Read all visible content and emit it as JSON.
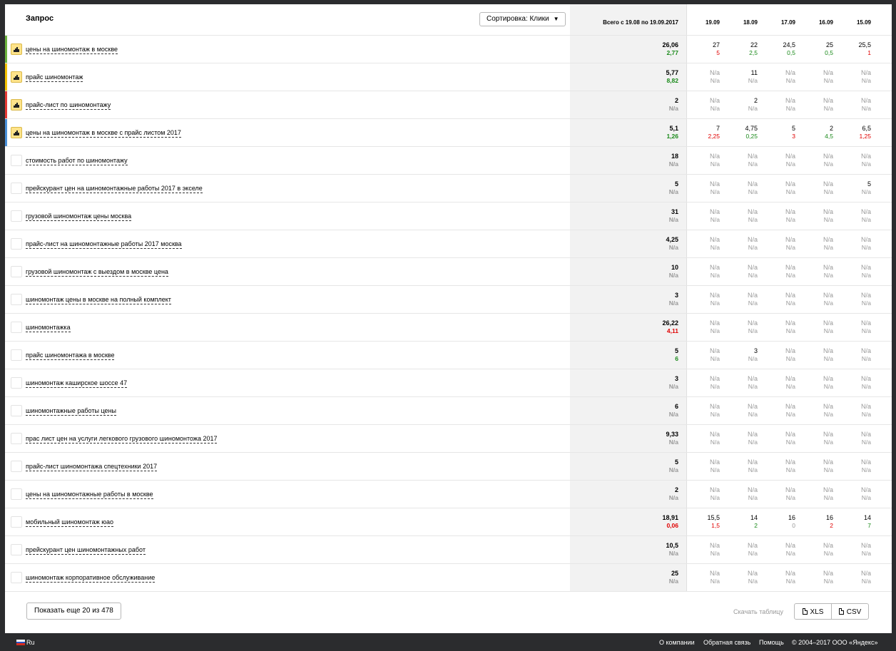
{
  "header": {
    "title": "Запрос",
    "sort_label": "Сортировка: Клики",
    "total_label": "Всего с 19.08 по 19.09.2017",
    "dates": [
      "19.09",
      "18.09",
      "17.09",
      "16.09",
      "15.09"
    ]
  },
  "colors": {
    "row_markers": [
      "#6cb33f",
      "#f2c200",
      "#e53935",
      "#4a90d9"
    ],
    "checkbox_on": "#ffe38a"
  },
  "rows": [
    {
      "query": "цены на шиномонтаж в москве",
      "checked": true,
      "marker": "#6cb33f",
      "total": {
        "a": "26,06",
        "b": "2,77",
        "bc": "green"
      },
      "days": [
        {
          "a": "27",
          "b": "5",
          "bc": "red"
        },
        {
          "a": "22",
          "b": "2,5",
          "bc": "green"
        },
        {
          "a": "24,5",
          "b": "0,5",
          "bc": "green"
        },
        {
          "a": "25",
          "b": "0,5",
          "bc": "green"
        },
        {
          "a": "25,5",
          "b": "1",
          "bc": "red"
        }
      ]
    },
    {
      "query": "прайс шиномонтаж",
      "checked": true,
      "marker": "#f2c200",
      "total": {
        "a": "5,77",
        "b": "8,82",
        "bc": "green"
      },
      "days": [
        {
          "a": "N/a",
          "b": "N/a"
        },
        {
          "a": "11",
          "b": "N/a"
        },
        {
          "a": "N/a",
          "b": "N/a"
        },
        {
          "a": "N/a",
          "b": "N/a"
        },
        {
          "a": "N/a",
          "b": "N/a"
        }
      ]
    },
    {
      "query": "прайс-лист по шиномонтажу",
      "checked": true,
      "marker": "#e53935",
      "total": {
        "a": "2",
        "b": "N/a"
      },
      "days": [
        {
          "a": "N/a",
          "b": "N/a"
        },
        {
          "a": "2",
          "b": "N/a"
        },
        {
          "a": "N/a",
          "b": "N/a"
        },
        {
          "a": "N/a",
          "b": "N/a"
        },
        {
          "a": "N/a",
          "b": "N/a"
        }
      ]
    },
    {
      "query": "цены на шиномонтаж в москве с прайс листом 2017",
      "checked": true,
      "marker": "#4a90d9",
      "total": {
        "a": "5,1",
        "b": "1,26",
        "bc": "green"
      },
      "days": [
        {
          "a": "7",
          "b": "2,25",
          "bc": "red"
        },
        {
          "a": "4,75",
          "b": "0,25",
          "bc": "green"
        },
        {
          "a": "5",
          "b": "3",
          "bc": "red"
        },
        {
          "a": "2",
          "b": "4,5",
          "bc": "green"
        },
        {
          "a": "6,5",
          "b": "1,25",
          "bc": "red"
        }
      ]
    },
    {
      "query": "стоимость работ по шиномонтажу",
      "total": {
        "a": "18",
        "b": "N/a"
      },
      "days": [
        {
          "a": "N/a",
          "b": "N/a"
        },
        {
          "a": "N/a",
          "b": "N/a"
        },
        {
          "a": "N/a",
          "b": "N/a"
        },
        {
          "a": "N/a",
          "b": "N/a"
        },
        {
          "a": "N/a",
          "b": "N/a"
        }
      ]
    },
    {
      "query": "прейскурант цен на шиномонтажные работы 2017 в экселе",
      "total": {
        "a": "5",
        "b": "N/a"
      },
      "days": [
        {
          "a": "N/a",
          "b": "N/a"
        },
        {
          "a": "N/a",
          "b": "N/a"
        },
        {
          "a": "N/a",
          "b": "N/a"
        },
        {
          "a": "N/a",
          "b": "N/a"
        },
        {
          "a": "5",
          "b": "N/a"
        }
      ]
    },
    {
      "query": "грузовой шиномонтаж цены москва",
      "total": {
        "a": "31",
        "b": "N/a"
      },
      "days": [
        {
          "a": "N/a",
          "b": "N/a"
        },
        {
          "a": "N/a",
          "b": "N/a"
        },
        {
          "a": "N/a",
          "b": "N/a"
        },
        {
          "a": "N/a",
          "b": "N/a"
        },
        {
          "a": "N/a",
          "b": "N/a"
        }
      ]
    },
    {
      "query": "прайс-лист на шиномонтажные работы 2017 москва",
      "total": {
        "a": "4,25",
        "b": "N/a"
      },
      "days": [
        {
          "a": "N/a",
          "b": "N/a"
        },
        {
          "a": "N/a",
          "b": "N/a"
        },
        {
          "a": "N/a",
          "b": "N/a"
        },
        {
          "a": "N/a",
          "b": "N/a"
        },
        {
          "a": "N/a",
          "b": "N/a"
        }
      ]
    },
    {
      "query": "грузовой шиномонтаж с выездом в москве цена",
      "total": {
        "a": "10",
        "b": "N/a"
      },
      "days": [
        {
          "a": "N/a",
          "b": "N/a"
        },
        {
          "a": "N/a",
          "b": "N/a"
        },
        {
          "a": "N/a",
          "b": "N/a"
        },
        {
          "a": "N/a",
          "b": "N/a"
        },
        {
          "a": "N/a",
          "b": "N/a"
        }
      ]
    },
    {
      "query": "шиномонтаж цены в москве на полный комплект",
      "total": {
        "a": "3",
        "b": "N/a"
      },
      "days": [
        {
          "a": "N/a",
          "b": "N/a"
        },
        {
          "a": "N/a",
          "b": "N/a"
        },
        {
          "a": "N/a",
          "b": "N/a"
        },
        {
          "a": "N/a",
          "b": "N/a"
        },
        {
          "a": "N/a",
          "b": "N/a"
        }
      ]
    },
    {
      "query": "шиномонтажка",
      "total": {
        "a": "26,22",
        "b": "4,11",
        "bc": "red"
      },
      "days": [
        {
          "a": "N/a",
          "b": "N/a"
        },
        {
          "a": "N/a",
          "b": "N/a"
        },
        {
          "a": "N/a",
          "b": "N/a"
        },
        {
          "a": "N/a",
          "b": "N/a"
        },
        {
          "a": "N/a",
          "b": "N/a"
        }
      ]
    },
    {
      "query": "прайс шиномонтажа в москве",
      "total": {
        "a": "5",
        "b": "6",
        "bc": "green"
      },
      "days": [
        {
          "a": "N/a",
          "b": "N/a"
        },
        {
          "a": "3",
          "b": "N/a"
        },
        {
          "a": "N/a",
          "b": "N/a"
        },
        {
          "a": "N/a",
          "b": "N/a"
        },
        {
          "a": "N/a",
          "b": "N/a"
        }
      ]
    },
    {
      "query": "шиномонтаж каширское шоссе 47",
      "total": {
        "a": "3",
        "b": "N/a"
      },
      "days": [
        {
          "a": "N/a",
          "b": "N/a"
        },
        {
          "a": "N/a",
          "b": "N/a"
        },
        {
          "a": "N/a",
          "b": "N/a"
        },
        {
          "a": "N/a",
          "b": "N/a"
        },
        {
          "a": "N/a",
          "b": "N/a"
        }
      ]
    },
    {
      "query": "шиномонтажные работы цены",
      "total": {
        "a": "6",
        "b": "N/a"
      },
      "days": [
        {
          "a": "N/a",
          "b": "N/a"
        },
        {
          "a": "N/a",
          "b": "N/a"
        },
        {
          "a": "N/a",
          "b": "N/a"
        },
        {
          "a": "N/a",
          "b": "N/a"
        },
        {
          "a": "N/a",
          "b": "N/a"
        }
      ]
    },
    {
      "query": "прас лист цен на услуги легкового грузового шиномонтожа 2017",
      "total": {
        "a": "9,33",
        "b": "N/a"
      },
      "days": [
        {
          "a": "N/a",
          "b": "N/a"
        },
        {
          "a": "N/a",
          "b": "N/a"
        },
        {
          "a": "N/a",
          "b": "N/a"
        },
        {
          "a": "N/a",
          "b": "N/a"
        },
        {
          "a": "N/a",
          "b": "N/a"
        }
      ]
    },
    {
      "query": "прайс-лист шиномонтажа спецтехники 2017",
      "total": {
        "a": "5",
        "b": "N/a"
      },
      "days": [
        {
          "a": "N/a",
          "b": "N/a"
        },
        {
          "a": "N/a",
          "b": "N/a"
        },
        {
          "a": "N/a",
          "b": "N/a"
        },
        {
          "a": "N/a",
          "b": "N/a"
        },
        {
          "a": "N/a",
          "b": "N/a"
        }
      ]
    },
    {
      "query": "цены на шиномонтажные работы в москве",
      "total": {
        "a": "2",
        "b": "N/a"
      },
      "days": [
        {
          "a": "N/a",
          "b": "N/a"
        },
        {
          "a": "N/a",
          "b": "N/a"
        },
        {
          "a": "N/a",
          "b": "N/a"
        },
        {
          "a": "N/a",
          "b": "N/a"
        },
        {
          "a": "N/a",
          "b": "N/a"
        }
      ]
    },
    {
      "query": "мобильный шиномонтаж юао",
      "total": {
        "a": "18,91",
        "b": "0,06",
        "bc": "red"
      },
      "days": [
        {
          "a": "15,5",
          "b": "1,5",
          "bc": "red"
        },
        {
          "a": "14",
          "b": "2",
          "bc": "green"
        },
        {
          "a": "16",
          "b": "0",
          "bc": "grey"
        },
        {
          "a": "16",
          "b": "2",
          "bc": "red"
        },
        {
          "a": "14",
          "b": "7",
          "bc": "green"
        }
      ]
    },
    {
      "query": "прейскурант цен шиномонтажных работ",
      "total": {
        "a": "10,5",
        "b": "N/a"
      },
      "days": [
        {
          "a": "N/a",
          "b": "N/a"
        },
        {
          "a": "N/a",
          "b": "N/a"
        },
        {
          "a": "N/a",
          "b": "N/a"
        },
        {
          "a": "N/a",
          "b": "N/a"
        },
        {
          "a": "N/a",
          "b": "N/a"
        }
      ]
    },
    {
      "query": "шиномонтаж корпоративное обслуживание",
      "total": {
        "a": "25",
        "b": "N/a"
      },
      "days": [
        {
          "a": "N/a",
          "b": "N/a"
        },
        {
          "a": "N/a",
          "b": "N/a"
        },
        {
          "a": "N/a",
          "b": "N/a"
        },
        {
          "a": "N/a",
          "b": "N/a"
        },
        {
          "a": "N/a",
          "b": "N/a"
        }
      ]
    }
  ],
  "bottom": {
    "more_label": "Показать еще 20 из 478",
    "download_label": "Скачать таблицу",
    "xls_label": "XLS",
    "csv_label": "CSV"
  },
  "footer": {
    "lang": "Ru",
    "links": [
      "О компании",
      "Обратная связь",
      "Помощь"
    ],
    "copyright": "© 2004–2017 ООО «Яндекс»"
  }
}
